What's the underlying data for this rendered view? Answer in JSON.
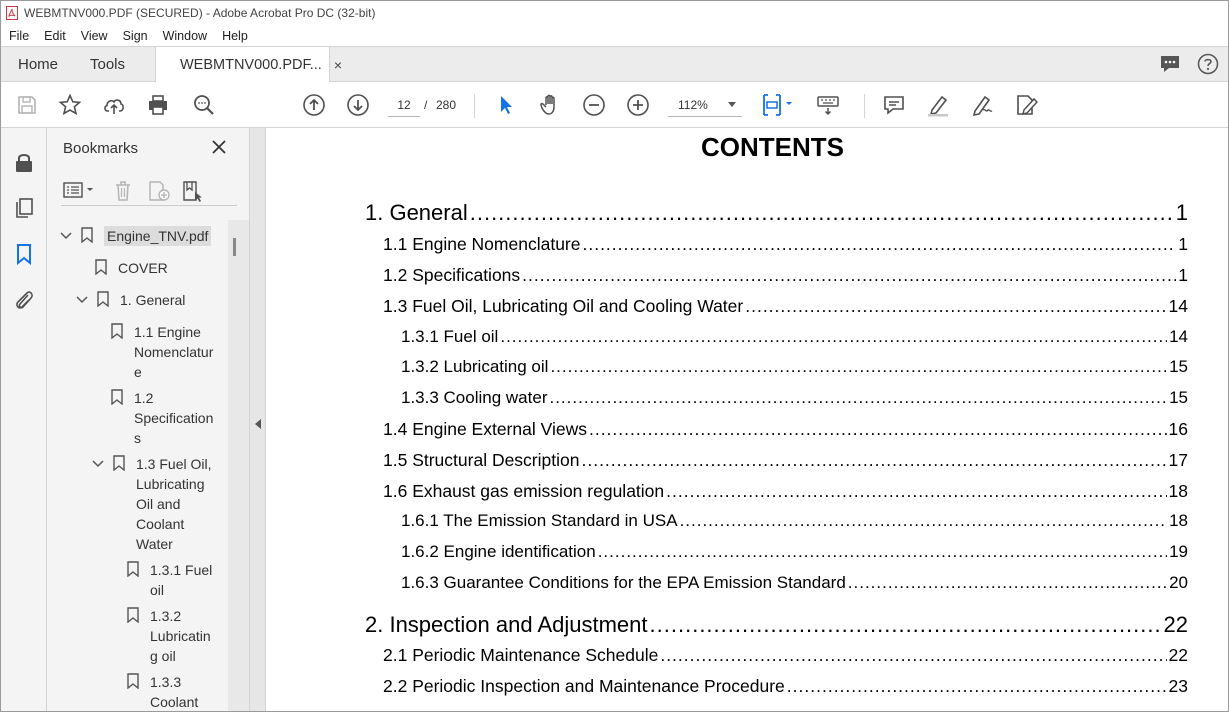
{
  "window": {
    "title": "WEBMTNV000.PDF (SECURED) - Adobe Acrobat Pro DC (32-bit)"
  },
  "menu": [
    "File",
    "Edit",
    "View",
    "Sign",
    "Window",
    "Help"
  ],
  "tabs": {
    "home": "Home",
    "tools": "Tools",
    "doc": "WEBMTNV000.PDF...",
    "close": "×"
  },
  "toolbar": {
    "page_current": "12",
    "page_sep": "/",
    "page_total": "280",
    "zoom": "112%"
  },
  "bookmarks": {
    "title": "Bookmarks",
    "items": [
      {
        "label": "Engine_TNV.pdf"
      },
      {
        "label": "COVER"
      },
      {
        "label": "1. General"
      },
      {
        "l1": "1.1 Engine",
        "l2": "Nomenclatur",
        "l3": "e"
      },
      {
        "l1": "1.2",
        "l2": "Specification",
        "l3": "s"
      },
      {
        "l1": "1.3 Fuel Oil,",
        "l2": "Lubricating",
        "l3": "Oil and",
        "l4": "Coolant",
        "l5": "Water"
      },
      {
        "l1": "1.3.1 Fuel",
        "l2": "oil"
      },
      {
        "l1": "1.3.2",
        "l2": "Lubricatin",
        "l3": "g oil"
      },
      {
        "l1": "1.3.3",
        "l2": "Coolant"
      }
    ]
  },
  "document": {
    "heading": "CONTENTS",
    "toc": [
      {
        "title": "1. General",
        "page": "1",
        "level": 1
      },
      {
        "title": "1.1 Engine Nomenclature",
        "page": "1",
        "level": 2
      },
      {
        "title": "1.2 Specifications",
        "page": "1",
        "level": 2
      },
      {
        "title": "1.3 Fuel Oil, Lubricating Oil and Cooling Water",
        "page": "14",
        "level": 2
      },
      {
        "title": "1.3.1 Fuel oil",
        "page": "14",
        "level": 3
      },
      {
        "title": "1.3.2 Lubricating oil",
        "page": "15",
        "level": 3
      },
      {
        "title": "1.3.3 Cooling water",
        "page": "15",
        "level": 3
      },
      {
        "title": "1.4 Engine External Views",
        "page": "16",
        "level": 2
      },
      {
        "title": "1.5 Structural Description",
        "page": "17",
        "level": 2
      },
      {
        "title": "1.6 Exhaust gas emission regulation",
        "page": "18",
        "level": 2
      },
      {
        "title": "1.6.1 The Emission Standard in USA",
        "page": "18",
        "level": 3
      },
      {
        "title": "1.6.2 Engine identification",
        "page": "19",
        "level": 3
      },
      {
        "title": "1.6.3 Guarantee Conditions for the EPA Emission Standard",
        "page": "20",
        "level": 3
      },
      {
        "title": "2. Inspection and Adjustment",
        "page": "22",
        "level": 1
      },
      {
        "title": "2.1 Periodic Maintenance Schedule",
        "page": "22",
        "level": 2
      },
      {
        "title": "2.2 Periodic Inspection and Maintenance Procedure",
        "page": "23",
        "level": 2
      }
    ]
  },
  "colors": {
    "accent_blue": "#1473e6",
    "acrobat_red": "#d7373f",
    "icon_gray": "#505050"
  }
}
